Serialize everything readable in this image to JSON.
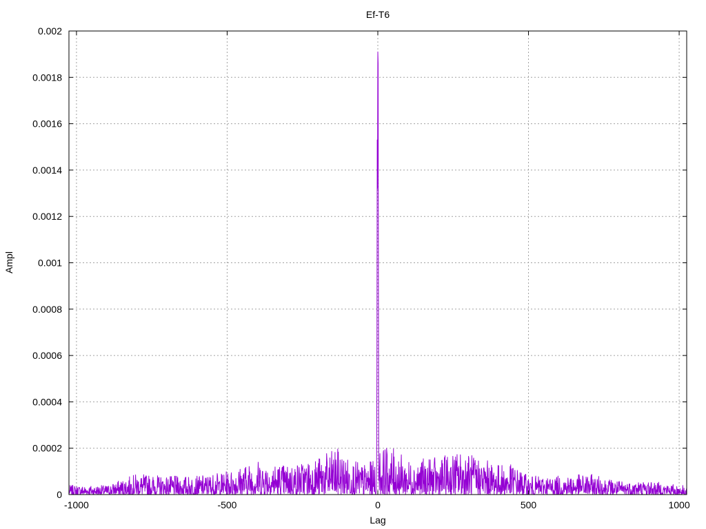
{
  "chart_data": {
    "type": "line",
    "title": "Ef-T6",
    "xlabel": "Lag",
    "ylabel": "Ampl",
    "xlim": [
      -1025,
      1025
    ],
    "ylim": [
      0,
      0.002
    ],
    "grid": true,
    "x_ticks": [
      -1000,
      -500,
      0,
      500,
      1000
    ],
    "x_tick_labels": [
      "-1000",
      "-500",
      "0",
      "500",
      "1000"
    ],
    "y_ticks": [
      0,
      0.0002,
      0.0004,
      0.0006,
      0.0008,
      0.001,
      0.0012,
      0.0014,
      0.0016,
      0.0018,
      0.002
    ],
    "y_tick_labels": [
      "0",
      "0.0002",
      "0.0004",
      "0.0006",
      "0.0008",
      "0.001",
      "0.0012",
      "0.0014",
      "0.0016",
      "0.0018",
      "0.002"
    ],
    "series": [
      {
        "color": "#9400d3",
        "x_range": [
          -1024,
          1024
        ],
        "peak": [
          [
            -6,
            1e-05
          ],
          [
            -5,
            2e-05
          ],
          [
            -4,
            0.00012
          ],
          [
            -3,
            0.00054
          ],
          [
            -2,
            0.00153
          ],
          [
            -1,
            0.00132
          ],
          [
            0,
            0.00191
          ],
          [
            1,
            0.00186
          ],
          [
            2,
            0.00101
          ],
          [
            3,
            6e-05
          ],
          [
            4,
            0.00012
          ],
          [
            5,
            2e-05
          ]
        ],
        "envelope": [
          {
            "lag": -1000,
            "max": 4e-05
          },
          {
            "lag": -900,
            "max": 4e-05
          },
          {
            "lag": -800,
            "max": 9e-05
          },
          {
            "lag": -700,
            "max": 8e-05
          },
          {
            "lag": -600,
            "max": 8e-05
          },
          {
            "lag": -500,
            "max": 0.0001
          },
          {
            "lag": -400,
            "max": 0.00015
          },
          {
            "lag": -300,
            "max": 0.00013
          },
          {
            "lag": -200,
            "max": 0.00016
          },
          {
            "lag": -135,
            "max": 0.0002
          },
          {
            "lag": -100,
            "max": 0.00016
          },
          {
            "lag": -50,
            "max": 0.00013
          },
          {
            "lag": -10,
            "max": 0.00015
          },
          {
            "lag": 10,
            "max": 0.00021
          },
          {
            "lag": 50,
            "max": 0.0002
          },
          {
            "lag": 100,
            "max": 0.00015
          },
          {
            "lag": 200,
            "max": 0.00016
          },
          {
            "lag": 280,
            "max": 0.00019
          },
          {
            "lag": 400,
            "max": 0.00013
          },
          {
            "lag": 450,
            "max": 0.00013
          },
          {
            "lag": 500,
            "max": 8e-05
          },
          {
            "lag": 600,
            "max": 8e-05
          },
          {
            "lag": 700,
            "max": 9e-05
          },
          {
            "lag": 800,
            "max": 6e-05
          },
          {
            "lag": 900,
            "max": 6e-05
          },
          {
            "lag": 1000,
            "max": 4e-05
          }
        ],
        "seed": 7
      }
    ]
  }
}
